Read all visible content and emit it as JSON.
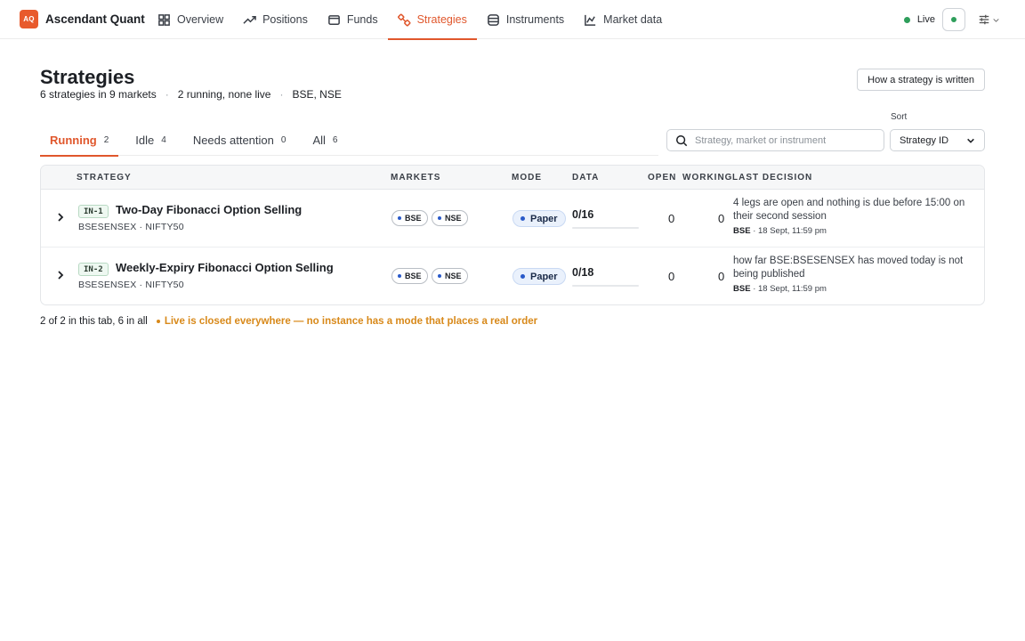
{
  "brand": {
    "logo": "AQ",
    "name": "Ascendant Quant"
  },
  "nav": {
    "items": [
      {
        "label": "Overview",
        "icon": "grid-icon"
      },
      {
        "label": "Positions",
        "icon": "trend-icon"
      },
      {
        "label": "Funds",
        "icon": "wallet-icon"
      },
      {
        "label": "Strategies",
        "icon": "strategy-icon",
        "active": true
      },
      {
        "label": "Instruments",
        "icon": "stack-icon"
      },
      {
        "label": "Market data",
        "icon": "chart-icon"
      }
    ],
    "live_label": "Live",
    "live_color": "#2e9e5b",
    "accent_color": "#e0572c"
  },
  "header": {
    "title": "Strategies",
    "summary": "6 strategies in 9 markets",
    "running": "2 running, none live",
    "markets": "BSE, NSE",
    "howto_button": "How a strategy is written"
  },
  "tabs": [
    {
      "label": "Running",
      "count": "2",
      "active": true
    },
    {
      "label": "Idle",
      "count": "4"
    },
    {
      "label": "Needs attention",
      "count": "0"
    },
    {
      "label": "All",
      "count": "6"
    }
  ],
  "search": {
    "placeholder": "Strategy, market or instrument",
    "value": ""
  },
  "sort": {
    "label": "Sort",
    "value": "Strategy ID"
  },
  "table": {
    "columns": [
      "STRATEGY",
      "MARKETS",
      "MODE",
      "DATA",
      "OPEN",
      "WORKING",
      "LAST DECISION"
    ],
    "rows": [
      {
        "id": "IN-1",
        "name": "Two-Day Fibonacci Option Selling",
        "sub": "BSESENSEX · NIFTY50",
        "markets": [
          "BSE",
          "NSE"
        ],
        "mode": "Paper",
        "data": "0/16",
        "data_fraction": 0,
        "open": "0",
        "working": "0",
        "decision": "4 legs are open and nothing is due before 15:00 on their second session",
        "decision_market": "BSE",
        "decision_time": "· 18 Sept, 11:59 pm"
      },
      {
        "id": "IN-2",
        "name": "Weekly-Expiry Fibonacci Option Selling",
        "sub": "BSESENSEX · NIFTY50",
        "markets": [
          "BSE",
          "NSE"
        ],
        "mode": "Paper",
        "data": "0/18",
        "data_fraction": 0,
        "open": "0",
        "working": "0",
        "decision": "how far BSE:BSESENSEX has moved today is not being published",
        "decision_market": "BSE",
        "decision_time": "· 18 Sept, 11:59 pm"
      }
    ]
  },
  "footer": {
    "count_text": "2 of 2 in this tab, 6 in all",
    "note": "Live is closed everywhere — no instance has a mode that places a real order"
  }
}
